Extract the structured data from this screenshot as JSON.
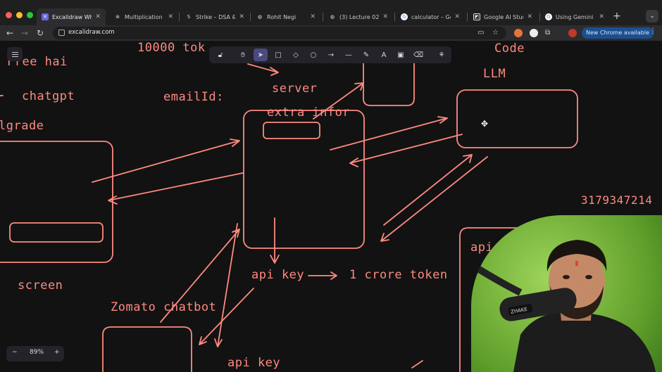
{
  "browser": {
    "tabs": [
      {
        "label": "Excalidraw Whi",
        "icon": "excalidraw-icon",
        "color": "#6965db",
        "active": true
      },
      {
        "label": "Multiplication re",
        "icon": "chatgpt-icon",
        "color": "#3a3a3a"
      },
      {
        "label": "Strike – DSA & C",
        "icon": "strike-icon",
        "color": "#3a3a3a"
      },
      {
        "label": "Rohit Negi",
        "icon": "globe-icon",
        "color": "#3a3a3a"
      },
      {
        "label": "(3) Lecture 02!",
        "icon": "globe-icon",
        "color": "#3a3a3a"
      },
      {
        "label": "calculator – Goo",
        "icon": "google-icon",
        "color": "#ffffff"
      },
      {
        "label": "Google AI Studio",
        "icon": "google-ai-icon",
        "color": "#1a1a1a"
      },
      {
        "label": "Using Gemini AI",
        "icon": "google-icon",
        "color": "#ffffff"
      }
    ],
    "new_tab": "+",
    "tab_search": "⌄",
    "url": "excalidraw.com",
    "update_button": "New Chrome available",
    "menu": "⋮"
  },
  "canvas": {
    "zoom_label": "89%",
    "zoom_minus": "−",
    "zoom_plus": "+",
    "texts": [
      {
        "id": "free-hai",
        "text": "Free hai"
      },
      {
        "id": "chatgpt",
        "text": "chatgpt"
      },
      {
        "id": "upgrade",
        "text": "lgrade"
      },
      {
        "id": "tokens",
        "text": "10000 tok"
      },
      {
        "id": "email",
        "text": "emailId:"
      },
      {
        "id": "server",
        "text": "server"
      },
      {
        "id": "extra",
        "text": "extra infor"
      },
      {
        "id": "code",
        "text": "Code"
      },
      {
        "id": "llm",
        "text": "LLM"
      },
      {
        "id": "number",
        "text": "3179347214"
      },
      {
        "id": "api-key-1",
        "text": "api key"
      },
      {
        "id": "crore",
        "text": "1 crore token"
      },
      {
        "id": "screen",
        "text": "screen"
      },
      {
        "id": "zomato",
        "text": "Zomato chatbot"
      },
      {
        "id": "api-key-2",
        "text": "api key"
      },
      {
        "id": "api-partial",
        "text": "api k"
      }
    ]
  },
  "webcam": {
    "mic_brand": "ZHAKE"
  },
  "colors": {
    "ink": "#ff8a80",
    "canvas": "#121212",
    "accent": "#6965db"
  }
}
